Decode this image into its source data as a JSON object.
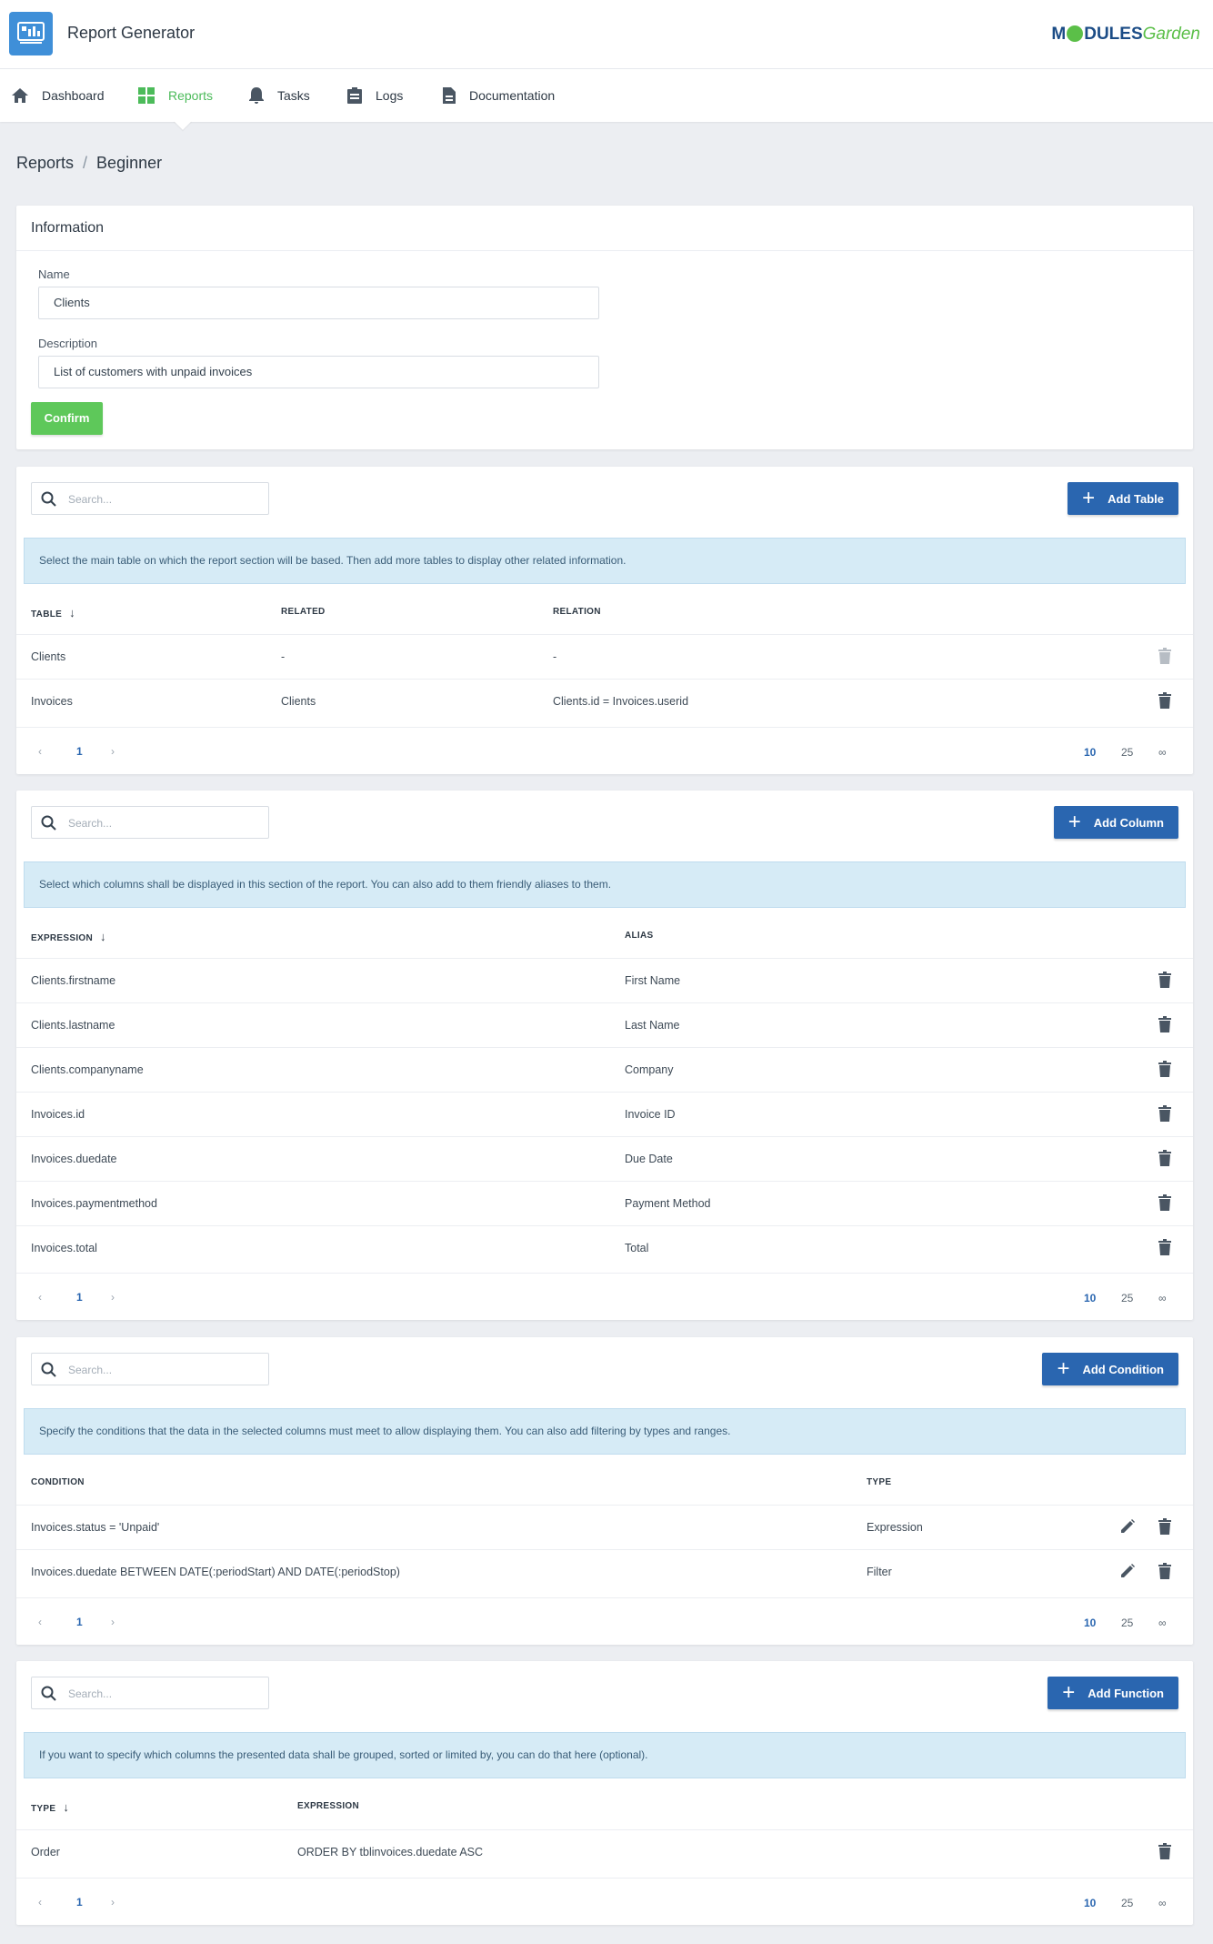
{
  "app": {
    "title": "Report Generator",
    "brand_prefix": "M",
    "brand_mid": "DULES",
    "brand_suffix": "Garden"
  },
  "nav": [
    {
      "label": "Dashboard",
      "icon": "home-icon"
    },
    {
      "label": "Reports",
      "icon": "reports-icon",
      "active": true
    },
    {
      "label": "Tasks",
      "icon": "bell-icon"
    },
    {
      "label": "Logs",
      "icon": "clipboard-icon"
    },
    {
      "label": "Documentation",
      "icon": "document-icon"
    }
  ],
  "breadcrumb": {
    "root": "Reports",
    "separator": "/",
    "current": "Beginner"
  },
  "information": {
    "title": "Information",
    "name_label": "Name",
    "name_value": "Clients",
    "description_label": "Description",
    "description_value": "List of customers with unpaid invoices",
    "confirm_label": "Confirm"
  },
  "search_placeholder": "Search...",
  "tables": {
    "add_label": "Add Table",
    "info": "Select the main table on which the report section will be based. Then add more tables to display other related information.",
    "headers": [
      "TABLE",
      "RELATED",
      "RELATION"
    ],
    "rows": [
      {
        "table": "Clients",
        "related": "-",
        "relation": "-"
      },
      {
        "table": "Invoices",
        "related": "Clients",
        "relation": "Clients.id = Invoices.userid"
      }
    ]
  },
  "columns": {
    "add_label": "Add Column",
    "info": "Select which columns shall be displayed in this section of the report. You can also add to them friendly aliases to them.",
    "headers": [
      "EXPRESSION",
      "ALIAS"
    ],
    "rows": [
      {
        "expression": "Clients.firstname",
        "alias": "First Name"
      },
      {
        "expression": "Clients.lastname",
        "alias": "Last Name"
      },
      {
        "expression": "Clients.companyname",
        "alias": "Company"
      },
      {
        "expression": "Invoices.id",
        "alias": "Invoice ID"
      },
      {
        "expression": "Invoices.duedate",
        "alias": "Due Date"
      },
      {
        "expression": "Invoices.paymentmethod",
        "alias": "Payment Method"
      },
      {
        "expression": "Invoices.total",
        "alias": "Total"
      }
    ]
  },
  "conditions": {
    "add_label": "Add Condition",
    "info": "Specify the conditions that the data in the selected columns must meet to allow displaying them. You can also add filtering by types and ranges.",
    "headers": [
      "CONDITION",
      "TYPE"
    ],
    "rows": [
      {
        "condition": "Invoices.status = 'Unpaid'",
        "type": "Expression"
      },
      {
        "condition": "Invoices.duedate BETWEEN DATE(:periodStart) AND DATE(:periodStop)",
        "type": "Filter"
      }
    ]
  },
  "functions": {
    "add_label": "Add Function",
    "info": "If you want to specify which columns the presented data shall be grouped, sorted or limited by, you can do that here (optional).",
    "headers": [
      "TYPE",
      "EXPRESSION"
    ],
    "rows": [
      {
        "type": "Order",
        "expression": "ORDER BY tblinvoices.duedate ASC"
      }
    ]
  },
  "pager": {
    "page": "1",
    "sizes": [
      "10",
      "25",
      "∞"
    ],
    "active_size": "10"
  },
  "colors": {
    "accent_green": "#5ec85a",
    "primary_blue": "#2a66b0",
    "info_bg": "#d6ebf6"
  }
}
